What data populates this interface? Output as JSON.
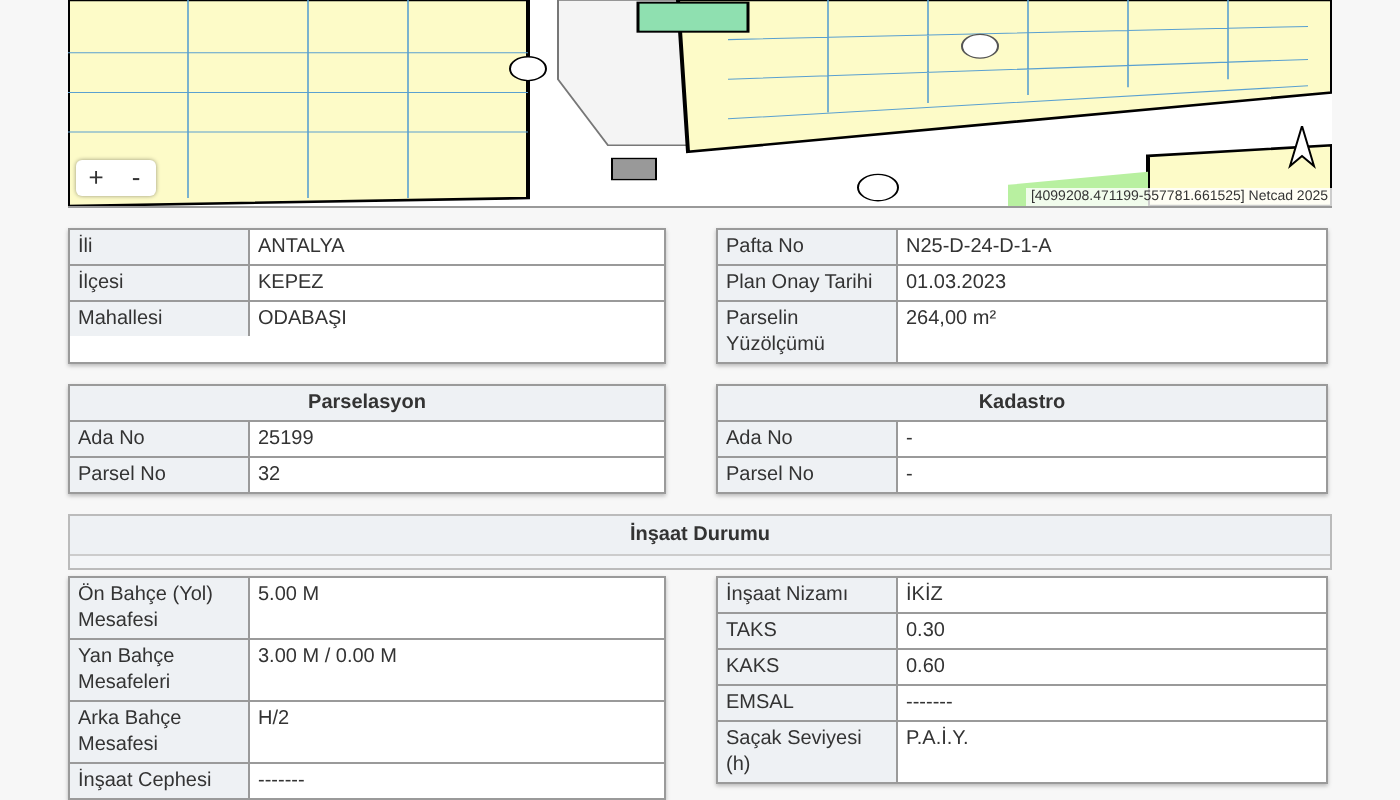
{
  "map": {
    "zoom_in": "+",
    "zoom_out": "-",
    "attribution": "[4099208.471199-557781.661525] Netcad 2025"
  },
  "location": [
    {
      "label": "İli",
      "value": "ANTALYA"
    },
    {
      "label": "İlçesi",
      "value": "KEPEZ"
    },
    {
      "label": "Mahallesi",
      "value": "ODABAŞI"
    }
  ],
  "plan": [
    {
      "label": "Pafta No",
      "value": "N25-D-24-D-1-A"
    },
    {
      "label": "Plan Onay Tarihi",
      "value": "01.03.2023"
    },
    {
      "label": "Parselin Yüzölçümü",
      "value": "264,00 m²"
    }
  ],
  "parselasyon": {
    "title": "Parselasyon",
    "rows": [
      {
        "label": "Ada No",
        "value": "25199"
      },
      {
        "label": "Parsel No",
        "value": "32"
      }
    ]
  },
  "kadastro": {
    "title": "Kadastro",
    "rows": [
      {
        "label": "Ada No",
        "value": "-"
      },
      {
        "label": "Parsel No",
        "value": "-"
      }
    ]
  },
  "insaat": {
    "title": "İnşaat Durumu",
    "left": [
      {
        "label": "Ön Bahçe (Yol) Mesafesi",
        "value": "5.00 M"
      },
      {
        "label": "Yan Bahçe Mesafeleri",
        "value": "3.00 M / 0.00 M"
      },
      {
        "label": "Arka Bahçe Mesafesi",
        "value": "H/2"
      },
      {
        "label": "İnşaat Cephesi",
        "value": "-------"
      }
    ],
    "right": [
      {
        "label": "İnşaat Nizamı",
        "value": "İKİZ"
      },
      {
        "label": "TAKS",
        "value": "0.30"
      },
      {
        "label": "KAKS",
        "value": "0.60"
      },
      {
        "label": "EMSAL",
        "value": "-------"
      },
      {
        "label": "Saçak Seviyesi (h)",
        "value": "P.A.İ.Y."
      }
    ]
  }
}
